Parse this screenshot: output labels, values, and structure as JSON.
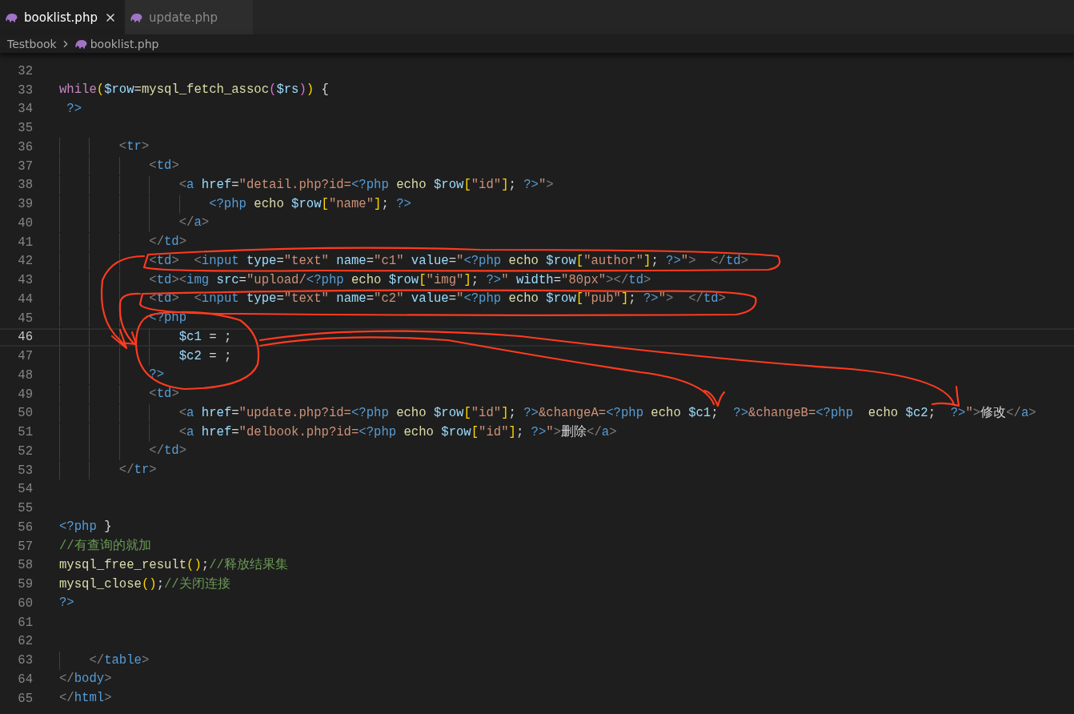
{
  "tabs": [
    {
      "label": "booklist.php",
      "selected": true
    },
    {
      "label": "update.php",
      "selected": false
    }
  ],
  "breadcrumb": [
    "Testbook",
    "booklist.php"
  ],
  "lines": [
    {
      "number": "32",
      "current": false
    },
    {
      "number": "33",
      "current": false,
      "tokens": [
        {
          "kind": "kw",
          "text": "while"
        },
        {
          "kind": "brace",
          "text": "("
        },
        {
          "kind": "var",
          "text": "$row"
        },
        {
          "kind": "plain",
          "text": "="
        },
        {
          "kind": "fn",
          "text": "mysql_fetch_assoc"
        },
        {
          "kind": "brace2",
          "text": "("
        },
        {
          "kind": "var",
          "text": "$rs"
        },
        {
          "kind": "brace2",
          "text": ")"
        },
        {
          "kind": "brace",
          "text": ")"
        },
        {
          "kind": "plain",
          "text": " {"
        }
      ]
    },
    {
      "number": "34",
      "current": false,
      "tokens": [
        {
          "kind": "php",
          "text": " ?>"
        }
      ]
    },
    {
      "number": "35",
      "current": false
    },
    {
      "number": "36",
      "current": false,
      "tokens": [
        {
          "kind": "punct",
          "text": "        <"
        },
        {
          "kind": "tag",
          "text": "tr"
        },
        {
          "kind": "punct",
          "text": ">"
        }
      ]
    },
    {
      "number": "37",
      "current": false,
      "tokens": [
        {
          "kind": "punct",
          "text": "            <"
        },
        {
          "kind": "tag",
          "text": "td"
        },
        {
          "kind": "punct",
          "text": ">"
        }
      ]
    },
    {
      "number": "38",
      "current": false,
      "tokens": [
        {
          "kind": "punct",
          "text": "                <"
        },
        {
          "kind": "tag",
          "text": "a"
        },
        {
          "kind": "attr",
          "text": " href"
        },
        {
          "kind": "plain",
          "text": "="
        },
        {
          "kind": "str",
          "text": "\"detail.php?id="
        },
        {
          "kind": "php",
          "text": "<?php"
        },
        {
          "kind": "fn",
          "text": " echo "
        },
        {
          "kind": "var",
          "text": "$row"
        },
        {
          "kind": "brace",
          "text": "["
        },
        {
          "kind": "str",
          "text": "\"id\""
        },
        {
          "kind": "brace",
          "text": "]"
        },
        {
          "kind": "plain",
          "text": "; "
        },
        {
          "kind": "php",
          "text": "?>"
        },
        {
          "kind": "str",
          "text": "\""
        },
        {
          "kind": "punct",
          "text": ">"
        }
      ]
    },
    {
      "number": "39",
      "current": false,
      "tokens": [
        {
          "kind": "php",
          "text": "                    <?php"
        },
        {
          "kind": "fn",
          "text": " echo "
        },
        {
          "kind": "var",
          "text": "$row"
        },
        {
          "kind": "brace",
          "text": "["
        },
        {
          "kind": "str",
          "text": "\"name\""
        },
        {
          "kind": "brace",
          "text": "]"
        },
        {
          "kind": "plain",
          "text": "; "
        },
        {
          "kind": "php",
          "text": "?>"
        }
      ]
    },
    {
      "number": "40",
      "current": false,
      "tokens": [
        {
          "kind": "punct",
          "text": "                </"
        },
        {
          "kind": "tag",
          "text": "a"
        },
        {
          "kind": "punct",
          "text": ">"
        }
      ]
    },
    {
      "number": "41",
      "current": false,
      "tokens": [
        {
          "kind": "punct",
          "text": "            </"
        },
        {
          "kind": "tag",
          "text": "td"
        },
        {
          "kind": "punct",
          "text": ">"
        }
      ]
    },
    {
      "number": "42",
      "current": false,
      "tokens": [
        {
          "kind": "punct",
          "text": "            <"
        },
        {
          "kind": "tag",
          "text": "td"
        },
        {
          "kind": "punct",
          "text": ">  <"
        },
        {
          "kind": "tag",
          "text": "input"
        },
        {
          "kind": "attr",
          "text": " type"
        },
        {
          "kind": "plain",
          "text": "="
        },
        {
          "kind": "str",
          "text": "\"text\""
        },
        {
          "kind": "attr",
          "text": " name"
        },
        {
          "kind": "plain",
          "text": "="
        },
        {
          "kind": "str",
          "text": "\"c1\""
        },
        {
          "kind": "attr",
          "text": " value"
        },
        {
          "kind": "plain",
          "text": "="
        },
        {
          "kind": "str",
          "text": "\""
        },
        {
          "kind": "php",
          "text": "<?php"
        },
        {
          "kind": "fn",
          "text": " echo "
        },
        {
          "kind": "var",
          "text": "$row"
        },
        {
          "kind": "brace",
          "text": "["
        },
        {
          "kind": "str",
          "text": "\"author\""
        },
        {
          "kind": "brace",
          "text": "]"
        },
        {
          "kind": "plain",
          "text": "; "
        },
        {
          "kind": "php",
          "text": "?>"
        },
        {
          "kind": "str",
          "text": "\""
        },
        {
          "kind": "punct",
          "text": ">  </"
        },
        {
          "kind": "tag",
          "text": "td"
        },
        {
          "kind": "punct",
          "text": ">"
        }
      ]
    },
    {
      "number": "43",
      "current": false,
      "tokens": [
        {
          "kind": "punct",
          "text": "            <"
        },
        {
          "kind": "tag",
          "text": "td"
        },
        {
          "kind": "punct",
          "text": "><"
        },
        {
          "kind": "tag",
          "text": "img"
        },
        {
          "kind": "attr",
          "text": " src"
        },
        {
          "kind": "plain",
          "text": "="
        },
        {
          "kind": "str",
          "text": "\"upload/"
        },
        {
          "kind": "php",
          "text": "<?php"
        },
        {
          "kind": "fn",
          "text": " echo "
        },
        {
          "kind": "var",
          "text": "$row"
        },
        {
          "kind": "brace",
          "text": "["
        },
        {
          "kind": "str",
          "text": "\"img\""
        },
        {
          "kind": "brace",
          "text": "]"
        },
        {
          "kind": "plain",
          "text": "; "
        },
        {
          "kind": "php",
          "text": "?>"
        },
        {
          "kind": "str",
          "text": "\""
        },
        {
          "kind": "attr",
          "text": " width"
        },
        {
          "kind": "plain",
          "text": "="
        },
        {
          "kind": "str",
          "text": "\"80px\""
        },
        {
          "kind": "punct",
          "text": "></"
        },
        {
          "kind": "tag",
          "text": "td"
        },
        {
          "kind": "punct",
          "text": ">"
        }
      ]
    },
    {
      "number": "44",
      "current": false,
      "tokens": [
        {
          "kind": "punct",
          "text": "            <"
        },
        {
          "kind": "tag",
          "text": "td"
        },
        {
          "kind": "punct",
          "text": ">  <"
        },
        {
          "kind": "tag",
          "text": "input"
        },
        {
          "kind": "attr",
          "text": " type"
        },
        {
          "kind": "plain",
          "text": "="
        },
        {
          "kind": "str",
          "text": "\"text\""
        },
        {
          "kind": "attr",
          "text": " name"
        },
        {
          "kind": "plain",
          "text": "="
        },
        {
          "kind": "str",
          "text": "\"c2\""
        },
        {
          "kind": "attr",
          "text": " value"
        },
        {
          "kind": "plain",
          "text": "="
        },
        {
          "kind": "str",
          "text": "\""
        },
        {
          "kind": "php",
          "text": "<?php"
        },
        {
          "kind": "fn",
          "text": " echo "
        },
        {
          "kind": "var",
          "text": "$row"
        },
        {
          "kind": "brace",
          "text": "["
        },
        {
          "kind": "str",
          "text": "\"pub\""
        },
        {
          "kind": "brace",
          "text": "]"
        },
        {
          "kind": "plain",
          "text": "; "
        },
        {
          "kind": "php",
          "text": "?>"
        },
        {
          "kind": "str",
          "text": "\""
        },
        {
          "kind": "punct",
          "text": ">  </"
        },
        {
          "kind": "tag",
          "text": "td"
        },
        {
          "kind": "punct",
          "text": ">"
        }
      ]
    },
    {
      "number": "45",
      "current": false,
      "tokens": [
        {
          "kind": "php",
          "text": "            <?php"
        }
      ]
    },
    {
      "number": "46",
      "current": true,
      "tokens": [
        {
          "kind": "var",
          "text": "                $c1"
        },
        {
          "kind": "plain",
          "text": " = ;"
        }
      ]
    },
    {
      "number": "47",
      "current": false,
      "tokens": [
        {
          "kind": "var",
          "text": "                $c2"
        },
        {
          "kind": "plain",
          "text": " = ;"
        }
      ]
    },
    {
      "number": "48",
      "current": false,
      "tokens": [
        {
          "kind": "php",
          "text": "            ?>"
        }
      ]
    },
    {
      "number": "49",
      "current": false,
      "tokens": [
        {
          "kind": "punct",
          "text": "            <"
        },
        {
          "kind": "tag",
          "text": "td"
        },
        {
          "kind": "punct",
          "text": ">"
        }
      ]
    },
    {
      "number": "50",
      "current": false,
      "tokens": [
        {
          "kind": "punct",
          "text": "                <"
        },
        {
          "kind": "tag",
          "text": "a"
        },
        {
          "kind": "attr",
          "text": " href"
        },
        {
          "kind": "plain",
          "text": "="
        },
        {
          "kind": "str",
          "text": "\"update.php?id="
        },
        {
          "kind": "php",
          "text": "<?php"
        },
        {
          "kind": "fn",
          "text": " echo "
        },
        {
          "kind": "var",
          "text": "$row"
        },
        {
          "kind": "brace",
          "text": "["
        },
        {
          "kind": "str",
          "text": "\"id\""
        },
        {
          "kind": "brace",
          "text": "]"
        },
        {
          "kind": "plain",
          "text": "; "
        },
        {
          "kind": "php",
          "text": "?>"
        },
        {
          "kind": "str",
          "text": "&changeA="
        },
        {
          "kind": "php",
          "text": "<?php"
        },
        {
          "kind": "fn",
          "text": " echo "
        },
        {
          "kind": "var",
          "text": "$c1"
        },
        {
          "kind": "plain",
          "text": ";  "
        },
        {
          "kind": "php",
          "text": "?>"
        },
        {
          "kind": "str",
          "text": "&changeB="
        },
        {
          "kind": "php",
          "text": "<?php"
        },
        {
          "kind": "fn",
          "text": "  echo "
        },
        {
          "kind": "var",
          "text": "$c2"
        },
        {
          "kind": "plain",
          "text": ";  "
        },
        {
          "kind": "php",
          "text": "?>"
        },
        {
          "kind": "str",
          "text": "\""
        },
        {
          "kind": "punct",
          "text": ">"
        },
        {
          "kind": "plain",
          "text": "修改"
        },
        {
          "kind": "punct",
          "text": "</"
        },
        {
          "kind": "tag",
          "text": "a"
        },
        {
          "kind": "punct",
          "text": ">"
        }
      ]
    },
    {
      "number": "51",
      "current": false,
      "tokens": [
        {
          "kind": "punct",
          "text": "                <"
        },
        {
          "kind": "tag",
          "text": "a"
        },
        {
          "kind": "attr",
          "text": " href"
        },
        {
          "kind": "plain",
          "text": "="
        },
        {
          "kind": "str",
          "text": "\"delbook.php?id="
        },
        {
          "kind": "php",
          "text": "<?php"
        },
        {
          "kind": "fn",
          "text": " echo "
        },
        {
          "kind": "var",
          "text": "$row"
        },
        {
          "kind": "brace",
          "text": "["
        },
        {
          "kind": "str",
          "text": "\"id\""
        },
        {
          "kind": "brace",
          "text": "]"
        },
        {
          "kind": "plain",
          "text": "; "
        },
        {
          "kind": "php",
          "text": "?>"
        },
        {
          "kind": "str",
          "text": "\""
        },
        {
          "kind": "punct",
          "text": ">"
        },
        {
          "kind": "plain",
          "text": "删除"
        },
        {
          "kind": "punct",
          "text": "</"
        },
        {
          "kind": "tag",
          "text": "a"
        },
        {
          "kind": "punct",
          "text": ">"
        }
      ]
    },
    {
      "number": "52",
      "current": false,
      "tokens": [
        {
          "kind": "punct",
          "text": "            </"
        },
        {
          "kind": "tag",
          "text": "td"
        },
        {
          "kind": "punct",
          "text": ">"
        }
      ]
    },
    {
      "number": "53",
      "current": false,
      "tokens": [
        {
          "kind": "punct",
          "text": "        </"
        },
        {
          "kind": "tag",
          "text": "tr"
        },
        {
          "kind": "punct",
          "text": ">"
        }
      ]
    },
    {
      "number": "54",
      "current": false
    },
    {
      "number": "55",
      "current": false
    },
    {
      "number": "56",
      "current": false,
      "tokens": [
        {
          "kind": "php",
          "text": "<?php"
        },
        {
          "kind": "plain",
          "text": " }"
        }
      ]
    },
    {
      "number": "57",
      "current": false,
      "tokens": [
        {
          "kind": "com",
          "text": "//有查询的就加"
        }
      ]
    },
    {
      "number": "58",
      "current": false,
      "tokens": [
        {
          "kind": "fn",
          "text": "mysql_free_result"
        },
        {
          "kind": "brace",
          "text": "()"
        },
        {
          "kind": "plain",
          "text": ";"
        },
        {
          "kind": "com",
          "text": "//释放结果集"
        }
      ]
    },
    {
      "number": "59",
      "current": false,
      "tokens": [
        {
          "kind": "fn",
          "text": "mysql_close"
        },
        {
          "kind": "brace",
          "text": "()"
        },
        {
          "kind": "plain",
          "text": ";"
        },
        {
          "kind": "com",
          "text": "//关闭连接"
        }
      ]
    },
    {
      "number": "60",
      "current": false,
      "tokens": [
        {
          "kind": "php",
          "text": "?>"
        }
      ]
    },
    {
      "number": "61",
      "current": false
    },
    {
      "number": "62",
      "current": false
    },
    {
      "number": "63",
      "current": false,
      "tokens": [
        {
          "kind": "punct",
          "text": "    </"
        },
        {
          "kind": "tag",
          "text": "table"
        },
        {
          "kind": "punct",
          "text": ">"
        }
      ]
    },
    {
      "number": "64",
      "current": false,
      "tokens": [
        {
          "kind": "punct",
          "text": "</"
        },
        {
          "kind": "tag",
          "text": "body"
        },
        {
          "kind": "punct",
          "text": ">"
        }
      ]
    },
    {
      "number": "65",
      "current": false,
      "tokens": [
        {
          "kind": "punct",
          "text": "</"
        },
        {
          "kind": "tag",
          "text": "html"
        },
        {
          "kind": "punct",
          "text": ">"
        }
      ]
    }
  ]
}
